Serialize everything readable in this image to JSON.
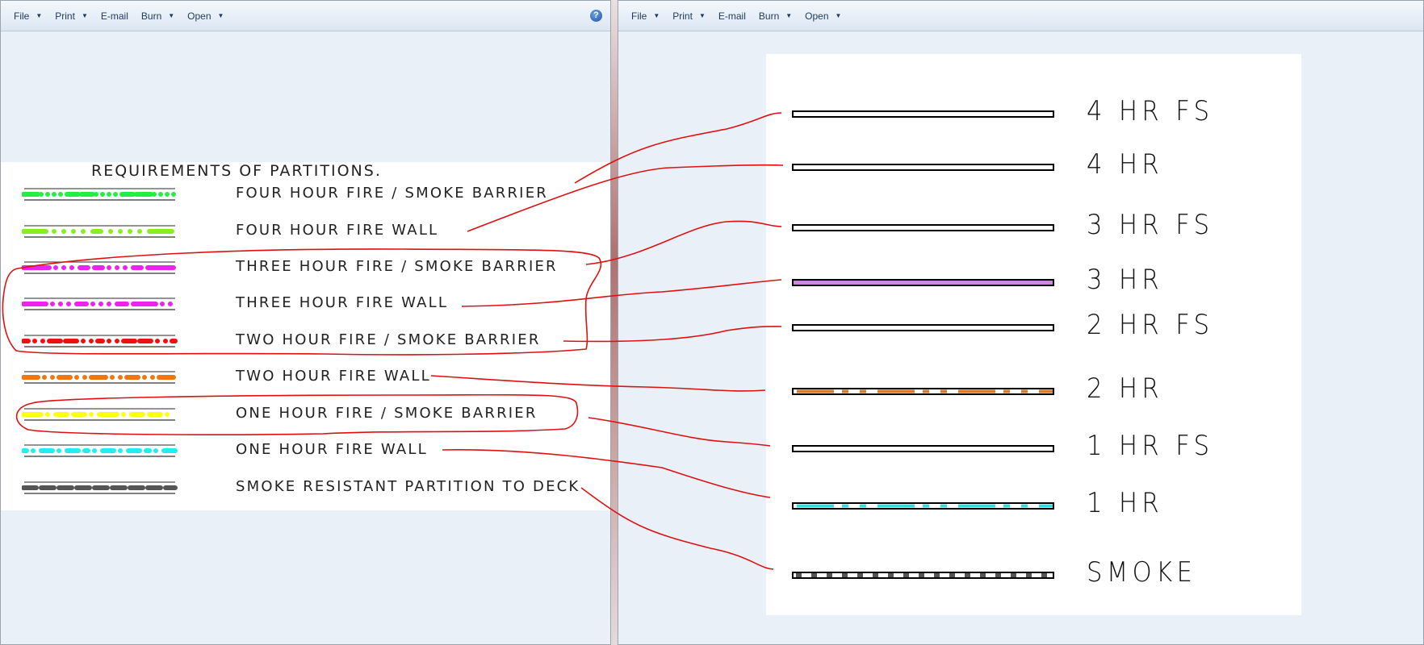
{
  "left_window": {
    "toolbar": [
      {
        "label": "File",
        "dropdown": true
      },
      {
        "label": "Print",
        "dropdown": true
      },
      {
        "label": "E-mail",
        "dropdown": false
      },
      {
        "label": "Burn",
        "dropdown": true
      },
      {
        "label": "Open",
        "dropdown": true
      }
    ],
    "help_icon": "?",
    "title": "REQUIREMENTS OF PARTITIONS.",
    "rows": [
      {
        "label": "FOUR HOUR FIRE / SMOKE BARRIER",
        "color": "#22ee44",
        "dash": "18 4 0 8 0 8 0 8 0 8 14 4 14 4 0 8 0 8 0 8 0 8 14 4"
      },
      {
        "label": "FOUR HOUR FIRE WALL",
        "color": "#88ee22",
        "dash": "28 10 0 12 0 12 0 12 0 12 10 12 0 12 0 12 0 12 0 12"
      },
      {
        "label": "THREE HOUR FIRE / SMOKE BARRIER",
        "color": "#ee22ee",
        "dash": "32 8 0 10 0 10 0 10 10 8 10 8 0 10 0 10 0 10 10 8"
      },
      {
        "label": "THREE HOUR FIRE WALL",
        "color": "#ee22ee",
        "dash": "28 8 0 10 0 10 0 10 12 8 0 10 0 10 0 10 12 8"
      },
      {
        "label": "TWO HOUR FIRE / SMOKE BARRIER",
        "color": "#ee1111",
        "dash": "6 8 0 10 0 8 14 6 14 8 0 10 0 8"
      },
      {
        "label": "TWO HOUR FIRE WALL",
        "color": "#ee7711",
        "dash": "18 8 0 10 0 8 14 8 0 10 0 8"
      },
      {
        "label": "ONE HOUR FIRE / SMOKE BARRIER",
        "color": "#ffff11",
        "dash": "22 8 0 10 14 8 14 8 0 10"
      },
      {
        "label": "ONE HOUR FIRE WALL",
        "color": "#22eeee",
        "dash": "4 8 0 10 14 8 0 10 14 8"
      },
      {
        "label": "SMOKE RESISTANT PARTITION TO DECK",
        "color": "#555555",
        "dash": "16 6"
      }
    ]
  },
  "right_window": {
    "toolbar": [
      {
        "label": "File",
        "dropdown": true
      },
      {
        "label": "Print",
        "dropdown": true
      },
      {
        "label": "E-mail",
        "dropdown": false
      },
      {
        "label": "Burn",
        "dropdown": true
      },
      {
        "label": "Open",
        "dropdown": true
      }
    ],
    "rows": [
      {
        "label": "4 HR FS",
        "fill": "#ffffff",
        "pattern": "solid"
      },
      {
        "label": "4 HR",
        "fill": "#ffffff",
        "pattern": "solid"
      },
      {
        "label": "3 HR FS",
        "fill": "#ffffff",
        "pattern": "solid"
      },
      {
        "label": "3 HR",
        "fill": "#cc88dd",
        "pattern": "solid"
      },
      {
        "label": "2 HR FS",
        "fill": "#ffffff",
        "pattern": "solid"
      },
      {
        "label": "2 HR",
        "fill": "#d97a28",
        "pattern": "dashdot"
      },
      {
        "label": "1 HR FS",
        "fill": "#ffffff",
        "pattern": "solid"
      },
      {
        "label": "1 HR",
        "fill": "#33dddd",
        "pattern": "dashdot"
      },
      {
        "label": "SMOKE",
        "fill": "#555555",
        "pattern": "hatch"
      }
    ]
  },
  "annotation_color": "#dd1111"
}
